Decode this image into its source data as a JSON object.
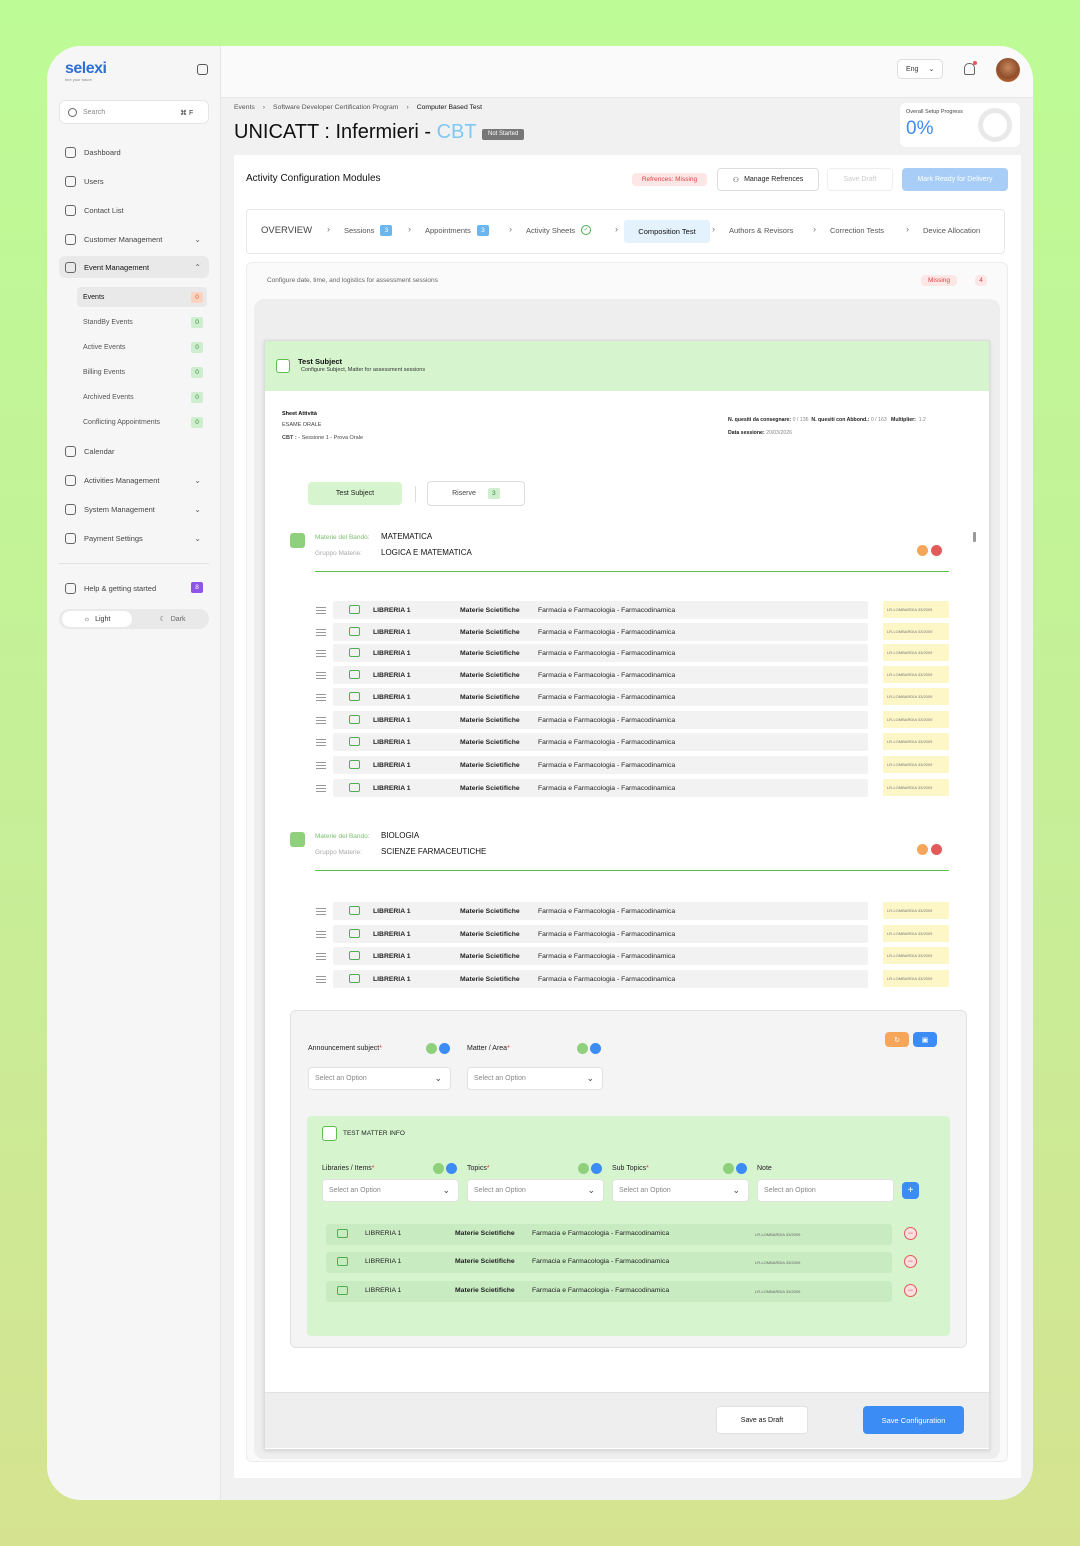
{
  "app": {
    "logo": "selexi",
    "tagline": "hire your future"
  },
  "search": {
    "placeholder": "Search",
    "shortcut": "⌘ F"
  },
  "nav": {
    "dashboard": "Dashboard",
    "users": "Users",
    "contact_list": "Contact List",
    "customer_management": "Customer Management",
    "event_management": "Event Management",
    "calendar": "Calendar",
    "activities_management": "Activities Management",
    "system_management": "System Management",
    "payment_settings": "Payment Settings",
    "help": "Help & getting started",
    "help_count": "8"
  },
  "subnav": [
    {
      "label": "Events",
      "count": "0"
    },
    {
      "label": "StandBy Events",
      "count": "0"
    },
    {
      "label": "Active Events",
      "count": "0"
    },
    {
      "label": "Billing Events",
      "count": "0"
    },
    {
      "label": "Archived Events",
      "count": "0"
    },
    {
      "label": "Conflicting Appointments",
      "count": "0"
    }
  ],
  "theme": {
    "light": "Light",
    "dark": "Dark"
  },
  "topbar": {
    "language": "Eng"
  },
  "breadcrumb": [
    "Events",
    "Software Developer Certification Program",
    "Computer Based Test"
  ],
  "page": {
    "title_a": "UNICATT : ",
    "title_b": "Infermieri - ",
    "title_c": "CBT",
    "status": "Not Started"
  },
  "progress": {
    "label": "Overall Setup Progress",
    "value": "0%",
    "fraction": 0
  },
  "section": {
    "title": "Activity Configuration Modules",
    "references_status": "Refrences: Missing",
    "manage_refs": "Manage Refrences",
    "save_draft": "Save Draft",
    "mark_ready": "Mark Ready for Delivery"
  },
  "tabs": {
    "overview": "OVERVIEW",
    "sessions": "Sessions",
    "sessions_count": "3",
    "appointments": "Appointments",
    "appointments_count": "3",
    "activity_sheets": "Activity Sheets",
    "composition": "Composition Test",
    "authors": "Authors & Revisors",
    "correction": "Correction Tests",
    "device": "Device Allocation"
  },
  "config": {
    "description": "Configure date, time, and logistics for assessment sessions",
    "missing": "Missing",
    "missing_count": "4"
  },
  "card": {
    "title": "Test Subject",
    "subtitle": "Configure Subject, Matter for assessment sessions"
  },
  "sheet": {
    "label": "Sheet Attività",
    "exam": "ESAME ORALE",
    "cbt_label": "CBT :",
    "cbt_value": "- Sessione 1 - Prova Orale",
    "q_deliver_label": "N. quesiti da consegnare:",
    "q_deliver_value": "0 / 136",
    "q_abbond_label": "N. quesiti con Abbond.:",
    "q_abbond_value": "0 / 163",
    "multiplier_label": "Multiplier:",
    "multiplier_value": "1.2",
    "date_label": "Data sessione:",
    "date_value": "20/03/2026"
  },
  "subtabs": {
    "test_subject": "Test Subject",
    "riserve": "Riserve",
    "riserve_count": "3"
  },
  "groups": [
    {
      "bando_label": "Materie del Bando:",
      "bando": "MATEMATICA",
      "gruppo_label": "Gruppo Materie:",
      "gruppo": "LOGICA E MATEMATICA",
      "rows": [
        {
          "lib": "LIBRERIA 1",
          "mat": "Materie Scietifiche",
          "far": "Farmacia e Farmacologia - Farmacodinamica",
          "tag": "LR-LOMBARDIA 33/2009"
        },
        {
          "lib": "LIBRERIA 1",
          "mat": "Materie Scietifiche",
          "far": "Farmacia e Farmacologia - Farmacodinamica",
          "tag": "LR-LOMBARDIA 33/2009"
        },
        {
          "lib": "LIBRERIA 1",
          "mat": "Materie Scietifiche",
          "far": "Farmacia e Farmacologia - Farmacodinamica",
          "tag": "LR-LOMBARDIA 33/2009"
        },
        {
          "lib": "LIBRERIA 1",
          "mat": "Materie Scietifiche",
          "far": "Farmacia e Farmacologia - Farmacodinamica",
          "tag": "LR-LOMBARDIA 33/2009"
        },
        {
          "lib": "LIBRERIA 1",
          "mat": "Materie Scietifiche",
          "far": "Farmacia e Farmacologia - Farmacodinamica",
          "tag": "LR-LOMBARDIA 33/2009"
        },
        {
          "lib": "LIBRERIA 1",
          "mat": "Materie Scietifiche",
          "far": "Farmacia e Farmacologia - Farmacodinamica",
          "tag": "LR-LOMBARDIA 33/2009"
        },
        {
          "lib": "LIBRERIA 1",
          "mat": "Materie Scietifiche",
          "far": "Farmacia e Farmacologia - Farmacodinamica",
          "tag": "LR-LOMBARDIA 33/2009"
        },
        {
          "lib": "LIBRERIA 1",
          "mat": "Materie Scietifiche",
          "far": "Farmacia e Farmacologia - Farmacodinamica",
          "tag": "LR-LOMBARDIA 33/2009"
        },
        {
          "lib": "LIBRERIA 1",
          "mat": "Materie Scietifiche",
          "far": "Farmacia e Farmacologia - Farmacodinamica",
          "tag": "LR-LOMBARDIA 33/2009"
        }
      ]
    },
    {
      "bando_label": "Materie del Bando:",
      "bando": "BIOLOGIA",
      "gruppo_label": "Gruppo Materie:",
      "gruppo": "SCIENZE FARMACEUTICHE",
      "rows": [
        {
          "lib": "LIBRERIA 1",
          "mat": "Materie Scietifiche",
          "far": "Farmacia e Farmacologia - Farmacodinamica",
          "tag": "LR-LOMBARDIA 33/2009"
        },
        {
          "lib": "LIBRERIA 1",
          "mat": "Materie Scietifiche",
          "far": "Farmacia e Farmacologia - Farmacodinamica",
          "tag": "LR-LOMBARDIA 33/2009"
        },
        {
          "lib": "LIBRERIA 1",
          "mat": "Materie Scietifiche",
          "far": "Farmacia e Farmacologia - Farmacodinamica",
          "tag": "LR-LOMBARDIA 33/2009"
        },
        {
          "lib": "LIBRERIA 1",
          "mat": "Materie Scietifiche",
          "far": "Farmacia e Farmacologia - Farmacodinamica",
          "tag": "LR-LOMBARDIA 33/2009"
        }
      ]
    }
  ],
  "form": {
    "announcement_label": "Announcement subject",
    "matter_label": "Matter / Area",
    "select_placeholder": "Select an Option",
    "info_title": "TEST MATTER  INFO",
    "libraries_label": "Libraries / Items",
    "topics_label": "Topics",
    "subtopics_label": "Sub Topics",
    "note_label": "Note"
  },
  "added_rows": [
    {
      "lib": "LIBRERIA 1",
      "mat": "Materie Scietifiche",
      "far": "Farmacia e Farmacologia - Farmacodinamica",
      "tag": "LR-LOMBARDIA 33/2009"
    },
    {
      "lib": "LIBRERIA 1",
      "mat": "Materie Scietifiche",
      "far": "Farmacia e Farmacologia - Farmacodinamica",
      "tag": "LR-LOMBARDIA 33/2009"
    },
    {
      "lib": "LIBRERIA 1",
      "mat": "Materie Scietifiche",
      "far": "Farmacia e Farmacologia - Farmacodinamica",
      "tag": "LR-LOMBARDIA 33/2009"
    }
  ],
  "footer": {
    "save_draft": "Save as Draft",
    "save_config": "Save Configuration"
  },
  "colors": {
    "accent": "#3b8cf5",
    "green": "#5cbf4a",
    "orange": "#f5a65b",
    "red": "#e35a5a"
  }
}
